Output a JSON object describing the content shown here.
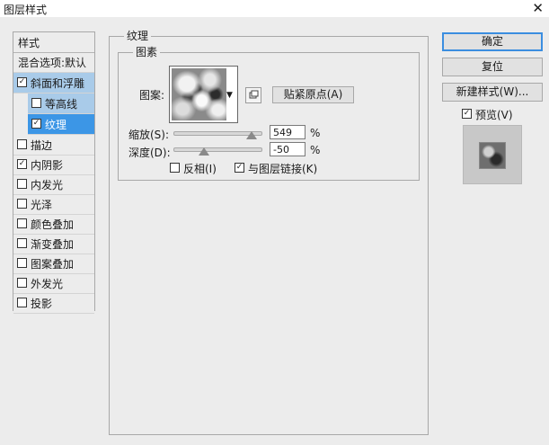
{
  "window": {
    "title": "图层样式",
    "close_glyph": "✕"
  },
  "left_panel": {
    "header": "样式",
    "items": [
      {
        "label": "混合选项:默认",
        "checkbox": false
      },
      {
        "label": "斜面和浮雕",
        "checkbox": true,
        "checked": true,
        "state": "selected"
      },
      {
        "label": "等高线",
        "checkbox": true,
        "checked": false,
        "sub": true
      },
      {
        "label": "纹理",
        "checkbox": true,
        "checked": true,
        "sub": true,
        "state": "current"
      },
      {
        "label": "描边",
        "checkbox": true,
        "checked": false
      },
      {
        "label": "内阴影",
        "checkbox": true,
        "checked": true
      },
      {
        "label": "内发光",
        "checkbox": true,
        "checked": false
      },
      {
        "label": "光泽",
        "checkbox": true,
        "checked": false
      },
      {
        "label": "颜色叠加",
        "checkbox": true,
        "checked": false
      },
      {
        "label": "渐变叠加",
        "checkbox": true,
        "checked": false
      },
      {
        "label": "图案叠加",
        "checkbox": true,
        "checked": false
      },
      {
        "label": "外发光",
        "checkbox": true,
        "checked": false
      },
      {
        "label": "投影",
        "checkbox": true,
        "checked": false
      }
    ]
  },
  "texture": {
    "section_title": "纹理",
    "group_title": "图素",
    "pattern_label": "图案:",
    "snap_button": "贴紧原点(A)",
    "scale_label": "缩放(S):",
    "scale_value": "549",
    "scale_percent": 0.9,
    "depth_label": "深度(D):",
    "depth_value": "-50",
    "depth_percent": 0.35,
    "percent_unit": "%",
    "invert_label": "反相(I)",
    "invert_checked": false,
    "link_label": "与图层链接(K)",
    "link_checked": true
  },
  "buttons": {
    "ok": "确定",
    "reset": "复位",
    "new_style": "新建样式(W)..."
  },
  "preview": {
    "label": "预览(V)",
    "checked": true
  },
  "check_glyph": "✓",
  "colors": {
    "selected_bg": "#a9cbe9",
    "current_bg": "#3c96e6",
    "default_button_border": "#3b8ee0"
  }
}
